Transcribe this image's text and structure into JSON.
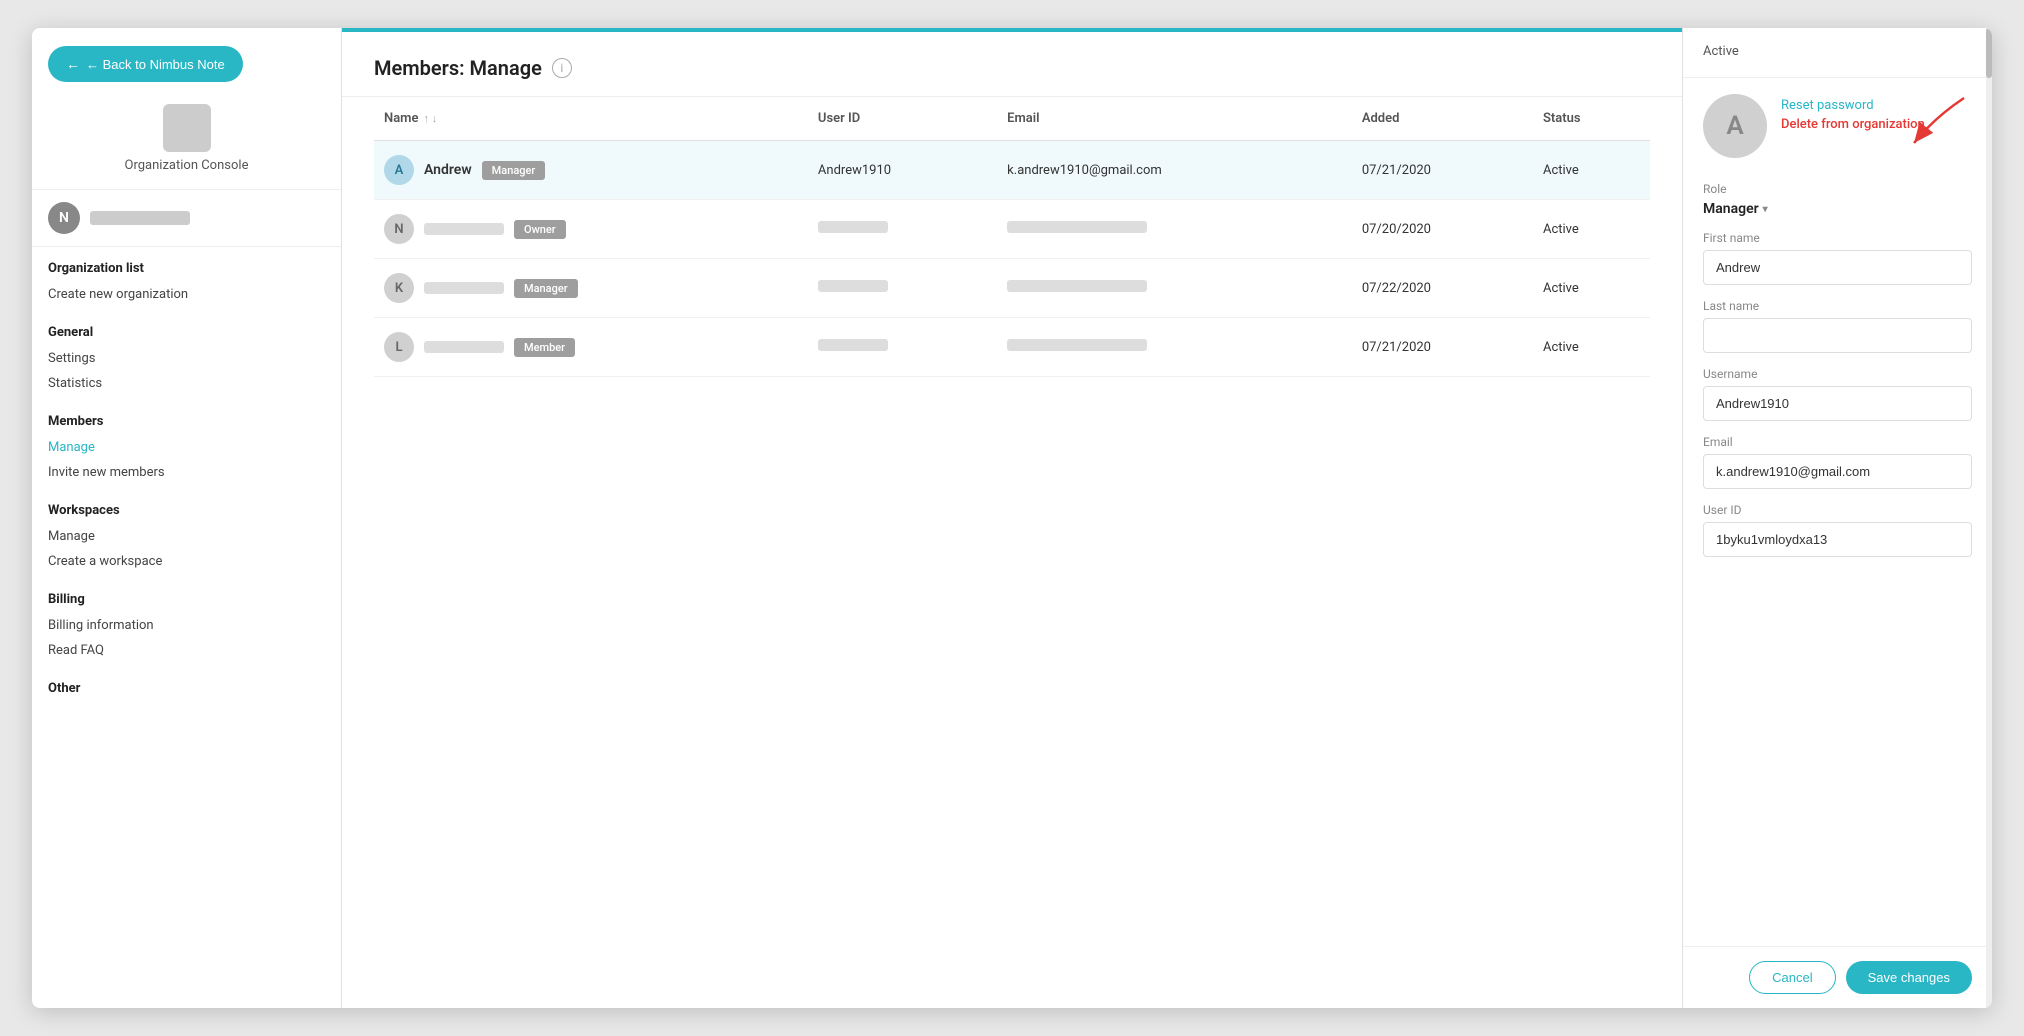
{
  "sidebar": {
    "back_btn": "← Back to Nimbus Note",
    "org_label": "Organization Console",
    "user_initial": "N",
    "sections": [
      {
        "title": "Organization list",
        "items": [
          {
            "label": "Create new organization",
            "active": false
          }
        ]
      },
      {
        "title": "General",
        "items": [
          {
            "label": "Settings",
            "active": false
          },
          {
            "label": "Statistics",
            "active": false
          }
        ]
      },
      {
        "title": "Members",
        "items": [
          {
            "label": "Manage",
            "active": true
          },
          {
            "label": "Invite new members",
            "active": false
          }
        ]
      },
      {
        "title": "Workspaces",
        "items": [
          {
            "label": "Manage",
            "active": false
          },
          {
            "label": "Create a workspace",
            "active": false
          }
        ]
      },
      {
        "title": "Billing",
        "items": [
          {
            "label": "Billing information",
            "active": false
          },
          {
            "label": "Read FAQ",
            "active": false
          }
        ]
      },
      {
        "title": "Other",
        "items": []
      }
    ]
  },
  "main": {
    "title": "Members: Manage",
    "columns": [
      "Name",
      "User ID",
      "Email",
      "Added",
      "Status"
    ],
    "rows": [
      {
        "initial": "A",
        "name": "Andrew",
        "role": "Manager",
        "user_id": "Andrew1910",
        "email": "k.andrew1910@gmail.com",
        "added": "07/21/2020",
        "status": "Active",
        "highlighted": true
      },
      {
        "initial": "N",
        "name": "",
        "role": "Owner",
        "user_id": "",
        "email": "",
        "added": "07/20/2020",
        "status": "Active",
        "highlighted": false
      },
      {
        "initial": "K",
        "name": "",
        "role": "Manager",
        "user_id": "",
        "email": "",
        "added": "07/22/2020",
        "status": "Active",
        "highlighted": false
      },
      {
        "initial": "L",
        "name": "",
        "role": "Member",
        "user_id": "",
        "email": "",
        "added": "07/21/2020",
        "status": "Active",
        "highlighted": false
      }
    ]
  },
  "right_panel": {
    "status": "Active",
    "avatar_initial": "A",
    "reset_password": "Reset password",
    "delete_org": "Delete from organization",
    "role_label": "Role",
    "role_value": "Manager",
    "first_name_label": "First name",
    "first_name_value": "Andrew",
    "last_name_label": "Last name",
    "last_name_value": "",
    "username_label": "Username",
    "username_value": "Andrew1910",
    "email_label": "Email",
    "email_value": "k.andrew1910@gmail.com",
    "user_id_label": "User ID",
    "user_id_value": "1byku1vmloydxa13",
    "cancel_btn": "Cancel",
    "save_btn": "Save changes"
  }
}
